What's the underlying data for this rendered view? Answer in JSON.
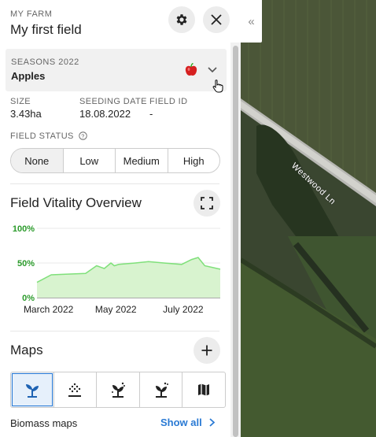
{
  "header": {
    "farm_label": "MY FARM",
    "field_name": "My first field"
  },
  "season": {
    "label": "SEASONS 2022",
    "crop": "Apples"
  },
  "stats": [
    {
      "label": "SIZE",
      "value": "3.43ha"
    },
    {
      "label": "SEEDING DATE",
      "value": "18.08.2022"
    },
    {
      "label": "FIELD ID",
      "value": "-"
    }
  ],
  "field_status": {
    "label": "FIELD STATUS",
    "options": [
      "None",
      "Low",
      "Medium",
      "High"
    ],
    "selected": "None"
  },
  "vitality": {
    "title": "Field Vitality Overview"
  },
  "chart_data": {
    "type": "area",
    "y_ticks": [
      "100%",
      "50%",
      "0%"
    ],
    "x_ticks": [
      "March 2022",
      "May 2022",
      "July 2022"
    ],
    "ylim": [
      0,
      100
    ],
    "x": [
      "2022-02-20",
      "2022-03-05",
      "2022-03-20",
      "2022-04-05",
      "2022-04-15",
      "2022-04-22",
      "2022-04-28",
      "2022-05-01",
      "2022-05-05",
      "2022-05-20",
      "2022-06-01",
      "2022-06-15",
      "2022-07-01",
      "2022-07-10",
      "2022-07-16",
      "2022-07-22",
      "2022-08-05"
    ],
    "values": [
      22,
      33,
      34,
      35,
      46,
      42,
      50,
      46,
      48,
      50,
      52,
      50,
      48,
      55,
      58,
      46,
      41
    ],
    "colors": {
      "fill": "#d8f3cf",
      "line": "#7fe07a",
      "axis_text": "#2a9a2a"
    }
  },
  "maps": {
    "title": "Maps",
    "tabs": [
      "biomass-icon",
      "seeding-icon",
      "crop-protection-icon",
      "fertilizing-icon",
      "map-icon"
    ]
  },
  "biomass": {
    "label": "Biomass maps",
    "show_all": "Show all"
  },
  "map_road_label": "Westwood Ln",
  "colors": {
    "accent": "#2a7ad4",
    "chart_fill": "#d8f3cf",
    "chart_line": "#7fe07a"
  }
}
